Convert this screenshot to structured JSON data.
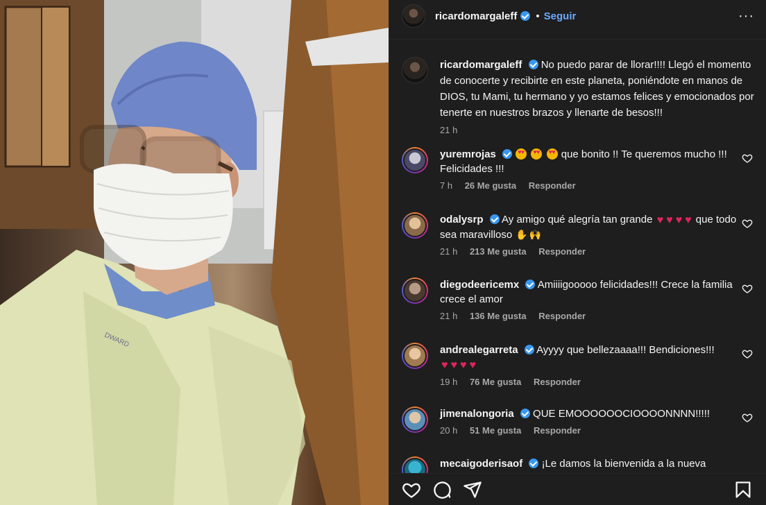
{
  "post": {
    "author": "ricardomargaleff",
    "separator": "•",
    "follow_label": "Seguir",
    "more_label": "···"
  },
  "caption": {
    "author": "ricardomargaleff",
    "text": "No puedo parar de llorar!!!! Llegó el momento de conocerte y recibirte en este planeta, poniéndote en manos de DIOS, tu Mami, tu hermano y yo estamos felices y emocionados por tenerte en nuestros brazos y llenarte de besos!!!",
    "time": "21 h"
  },
  "comments": [
    {
      "user": "yuremrojas",
      "text_before": "",
      "emoji": "hearteyes3",
      "text": "que bonito !! Te queremos mucho !!! Felicidades !!!",
      "time": "7 h",
      "likes": "26 Me gusta",
      "reply": "Responder"
    },
    {
      "user": "odalysrp",
      "text_before": "Ay amigo qué alegría tan grande",
      "emoji": "hearts4",
      "text": "que todo sea maravilloso",
      "emoji_after": "hands2",
      "time": "21 h",
      "likes": "213 Me gusta",
      "reply": "Responder"
    },
    {
      "user": "diegodeericemx",
      "text": "Amiiiigooooo felicidades!!! Crece la familia crece el amor",
      "time": "21 h",
      "likes": "136 Me gusta",
      "reply": "Responder"
    },
    {
      "user": "andrealegarreta",
      "text": "Ayyyy que bellezaaaa!!! Bendiciones!!!",
      "emoji": "hearts4",
      "time": "19 h",
      "likes": "76 Me gusta",
      "reply": "Responder"
    },
    {
      "user": "jimenalongoria",
      "text": "QUE EMOOOOOOCIOOOONNNN!!!!!",
      "time": "20 h",
      "likes": "51 Me gusta",
      "reply": "Responder"
    },
    {
      "user": "mecaigoderisaof",
      "text": "¡Le damos la bienvenida a la nueva",
      "time": "",
      "likes": "",
      "reply": ""
    }
  ],
  "footer_icons": [
    "like-icon",
    "comment-icon",
    "share-icon",
    "save-icon"
  ],
  "colors": {
    "background": "#1e1e1e",
    "link": "#6aa9ff",
    "verified": "#3897f0",
    "muted": "#a8a8a8"
  },
  "photo_text": "DWARD"
}
